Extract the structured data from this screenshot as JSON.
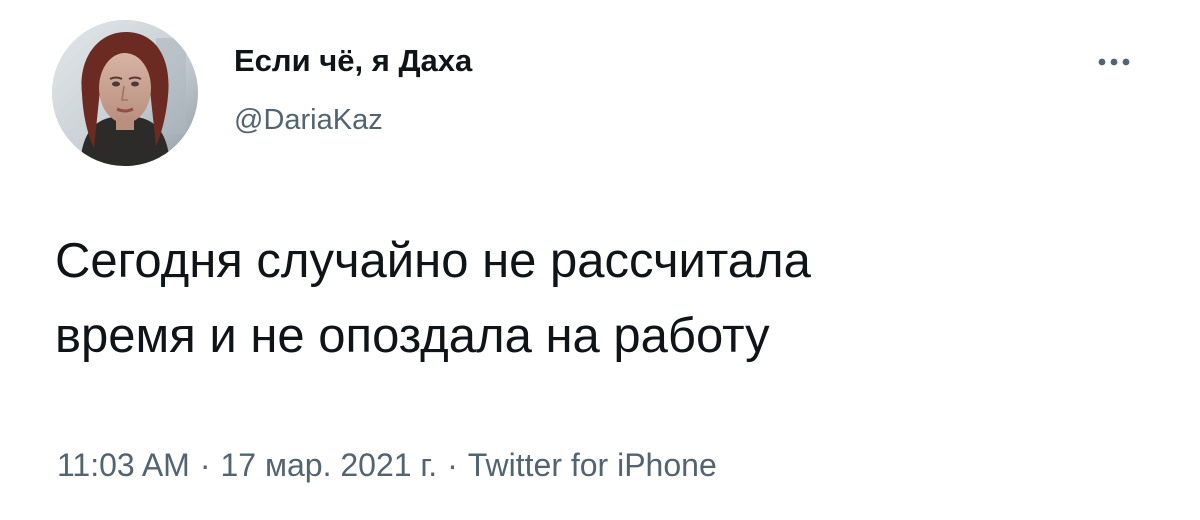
{
  "author": {
    "display_name": "Если чё, я Даха",
    "handle": "@DariaKaz"
  },
  "tweet": {
    "text": "Сегодня случайно не рассчитала\nвремя и не опоздала на работу"
  },
  "meta": {
    "time": "11:03 AM",
    "separator": "·",
    "date": "17 мар. 2021 г.",
    "source": "Twitter for iPhone"
  },
  "icons": {
    "more": "more-icon",
    "avatar": "avatar"
  },
  "colors": {
    "text": "#0f1419",
    "secondary": "#536471",
    "background": "#ffffff"
  }
}
